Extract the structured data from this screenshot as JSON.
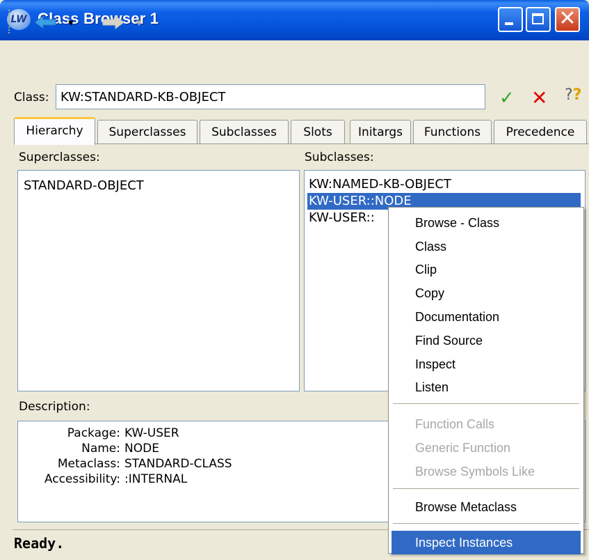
{
  "window": {
    "title": "Class Browser 1",
    "logo_text": "LW"
  },
  "class_field": {
    "label": "Class:",
    "value": "KW:STANDARD-KB-OBJECT"
  },
  "tabs": [
    {
      "label": "Hierarchy",
      "active": true
    },
    {
      "label": "Superclasses"
    },
    {
      "label": "Subclasses"
    },
    {
      "label": "Slots"
    },
    {
      "label": "Initargs"
    },
    {
      "label": "Functions"
    },
    {
      "label": "Precedence"
    }
  ],
  "superclasses": {
    "label": "Superclasses:",
    "items": [
      "STANDARD-OBJECT"
    ]
  },
  "subclasses": {
    "label": "Subclasses:",
    "items": [
      "KW:NAMED-KB-OBJECT",
      "KW-USER::NODE",
      "KW-USER::"
    ],
    "selected_index": 1
  },
  "description": {
    "label": "Description:",
    "rows": [
      {
        "key": "Package:",
        "value": "KW-USER"
      },
      {
        "key": "Name:",
        "value": "NODE"
      },
      {
        "key": "Metaclass:",
        "value": "STANDARD-CLASS"
      },
      {
        "key": "Accessibility:",
        "value": ":INTERNAL"
      }
    ]
  },
  "status": {
    "text": "Ready."
  },
  "context_menu": {
    "items": [
      {
        "label": "Browse - Class"
      },
      {
        "label": "Class"
      },
      {
        "label": "Clip"
      },
      {
        "label": "Copy"
      },
      {
        "label": "Documentation"
      },
      {
        "label": "Find Source"
      },
      {
        "label": "Inspect"
      },
      {
        "label": "Listen"
      },
      {
        "label": "Function Calls",
        "disabled": true
      },
      {
        "label": "Generic Function",
        "disabled": true
      },
      {
        "label": "Browse Symbols Like",
        "disabled": true
      },
      {
        "label": "Browse Metaclass"
      },
      {
        "label": "Inspect Instances",
        "highlighted": true
      }
    ]
  },
  "colors": {
    "title_bar": "#0453D8",
    "selection": "#316AC5",
    "accept": "#2EA62E",
    "cancel": "#E00000"
  }
}
